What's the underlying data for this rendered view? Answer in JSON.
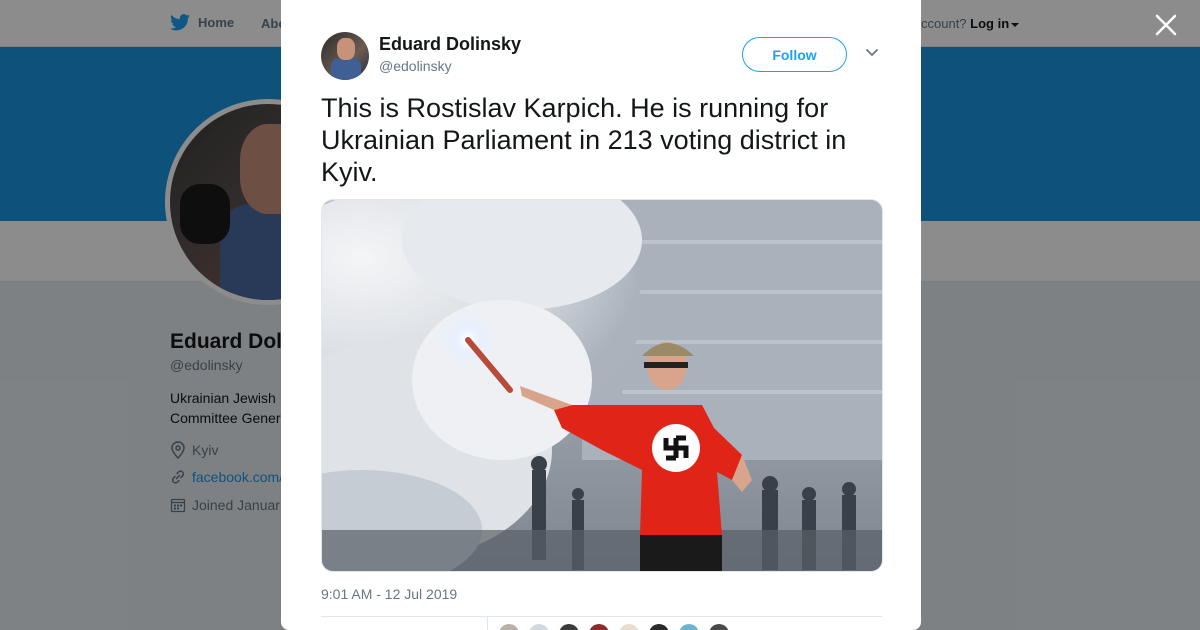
{
  "topnav": {
    "home_label": "Home",
    "about_label": "Abo",
    "account_text": "ccount?",
    "login_label": "Log in"
  },
  "profile": {
    "name": "Eduard Dolin",
    "handle": "@edolinsky",
    "bio": "Ukrainian Jewish Committee General",
    "location": "Kyiv",
    "website": "facebook.com/",
    "joined": "Joined Januar",
    "banner_color": "#1b95e0"
  },
  "tweet": {
    "author_name": "Eduard Dolinsky",
    "author_handle": "@edolinsky",
    "follow_label": "Follow",
    "text": "This is Rostislav Karpich. He is running for Ukrainian Parliament in 213 voting district in Kyiv.",
    "timestamp": "9:01 AM - 12 Jul 2019",
    "photo_description": "man in red swastika shirt holding flare on stadium field"
  },
  "icons": {
    "twitter": "bird-icon",
    "close": "close-icon",
    "caret": "caret-down-icon",
    "location": "map-pin-icon",
    "link": "link-icon",
    "calendar": "calendar-icon",
    "more": "chevron-down-icon"
  },
  "colors": {
    "accent": "#1da1f2",
    "text": "#14171a",
    "secondary": "#657786"
  }
}
